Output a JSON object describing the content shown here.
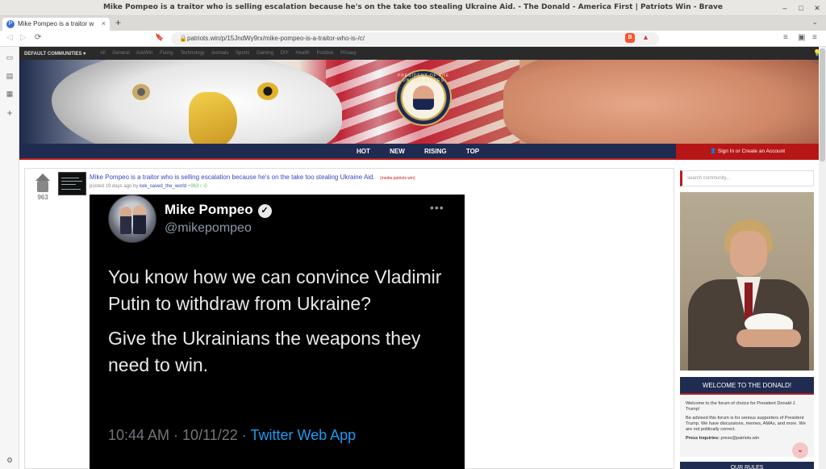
{
  "window": {
    "title": "Mike Pompeo is a traitor who is selling escalation because he's on the take too stealing Ukraine Aid. - The Donald - America First | Patriots Win - Brave",
    "minimize": "–",
    "maximize": "□",
    "close": "✕"
  },
  "tabs": [
    {
      "label": "Mike Pompeo is a traitor w",
      "favicon": "P"
    }
  ],
  "browser": {
    "new_tab": "+",
    "tab_list": "⌄",
    "url": "patriots.win/p/15JndWy9rx/mike-pompeo-is-a-traitor-who-is-/c/",
    "brave_shield": "B",
    "rewards": "▲",
    "back": "◁",
    "forward": "▷",
    "reload": "⟳",
    "bookmark": "🔖",
    "playlist": "≡",
    "sidebar": "▣",
    "menu": "≡"
  },
  "community_bar": {
    "default": "DEFAULT COMMUNITIES",
    "caret": "▾",
    "items": [
      "All",
      "General",
      "AskWin",
      "Funny",
      "Technology",
      "Animals",
      "Sports",
      "Gaming",
      "DIY",
      "Health",
      "Positive",
      "Privacy"
    ],
    "bulb": "💡"
  },
  "seal": {
    "text": "PRESIDENT OF THE UNITED STATES"
  },
  "nav": {
    "hot": "HOT",
    "new": "NEW",
    "rising": "RISING",
    "top": "TOP",
    "signin": "Sign In or Create an Account",
    "signin_icon": "👤"
  },
  "post": {
    "score": "963",
    "title": "Mike Pompeo is a traitor who is selling escalation because he's on the take too stealing Ukraine Aid.",
    "domain": "(media.patriots.win)",
    "posted": "posted 19 days ago by",
    "author": "kek_saved_the_world",
    "votes": "+963 / -0"
  },
  "tweet": {
    "name": "Mike Pompeo",
    "verified": "✓",
    "handle": "@mikepompeo",
    "more": "•••",
    "paragraph1": "You know how we can convince Vladimir Putin to withdraw from Ukraine?",
    "paragraph2": "Give the Ukrainians the weapons they need to win.",
    "time": "10:44 AM · 10/11/22 · ",
    "app": "Twitter Web App"
  },
  "sidebar": {
    "search_placeholder": "search community...",
    "welcome_title": "WELCOME TO THE DONALD!",
    "welcome_p1": "Welcome to the forum of choice for President Donald J. Trump!",
    "welcome_p2": "Be advised this forum is for serious supporters of President Trump. We have discussions, memes, AMAs, and more. We are not politically correct.",
    "press_label": "Press Inquiries:",
    "press_email": "press@patriots.win",
    "rules_title": "OUR RULES",
    "scroll_icon": "⌄"
  },
  "left_panel": {
    "icons": [
      "▭",
      "▤",
      "▦",
      "+",
      "⚙"
    ]
  }
}
